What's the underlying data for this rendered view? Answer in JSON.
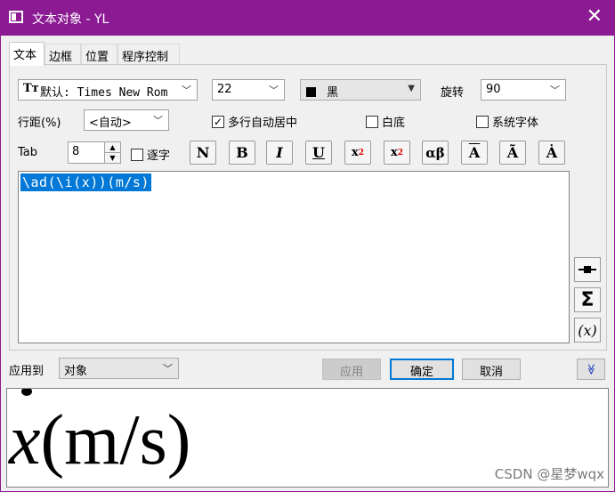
{
  "window": {
    "title": "文本对象 - YL"
  },
  "tabs": [
    {
      "label": "文本"
    },
    {
      "label": "边框"
    },
    {
      "label": "位置"
    },
    {
      "label": "程序控制"
    }
  ],
  "font": {
    "icon_glyph": "Tт",
    "value": "默认: Times New Rom"
  },
  "size": {
    "value": "22"
  },
  "color": {
    "value": "黑",
    "swatch": "#000000"
  },
  "rotation": {
    "label": "旋转",
    "value": "90"
  },
  "line_spacing": {
    "label": "行距(%)",
    "value": "<自动>"
  },
  "checkboxes": {
    "multiline_center": {
      "label": "多行自动居中",
      "checked": true
    },
    "white_bg": {
      "label": "白底",
      "checked": false
    },
    "system_font": {
      "label": "系统字体",
      "checked": false
    },
    "char_by_char": {
      "label": "逐字",
      "checked": false
    }
  },
  "tab": {
    "label": "Tab",
    "value": "8"
  },
  "format_buttons": {
    "normal": "N",
    "bold": "B",
    "italic": "I",
    "underline": "U",
    "superscript": "x",
    "superscript_mark": "2",
    "subscript": "x",
    "subscript_mark": "2",
    "greek": "αβ",
    "overbar": "A",
    "tilde": "Ã",
    "dot": "Ȧ"
  },
  "editor": {
    "text": "\\ad(\\i(x))(m/s)"
  },
  "side_buttons": {
    "sigma": "Σ",
    "func": "(x)"
  },
  "apply_to": {
    "label": "应用到",
    "value": "对象"
  },
  "buttons": {
    "apply": "应用",
    "ok": "确定",
    "cancel": "取消",
    "expand": "≫"
  },
  "preview": {
    "var": "x",
    "rest": "(m/s)"
  },
  "watermark": "CSDN @星梦wqx",
  "colors": {
    "titlebar": "#8b1a93",
    "selection": "#0078d7"
  }
}
